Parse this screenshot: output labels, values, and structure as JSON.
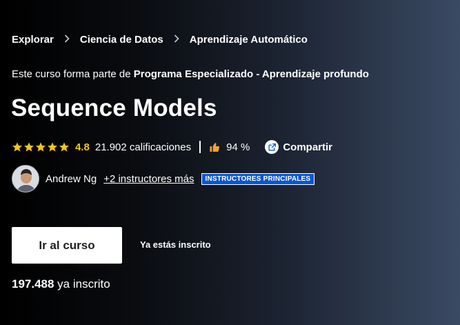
{
  "breadcrumb": {
    "items": [
      {
        "label": "Explorar"
      },
      {
        "label": "Ciencia de Datos"
      },
      {
        "label": "Aprendizaje Automático"
      }
    ]
  },
  "program": {
    "prefix": "Este curso forma parte de ",
    "name": "Programa Especializado - Aprendizaje profundo"
  },
  "course": {
    "title": "Sequence Models"
  },
  "ratings": {
    "stars": 5,
    "value": "4.8",
    "count_text": "21.902 calificaciones",
    "like_percent": "94 %",
    "star_color": "#f5c518",
    "icons": [
      "star-icon",
      "thumbs-up-icon",
      "share-icon"
    ]
  },
  "share": {
    "label": "Compartir"
  },
  "instructors": {
    "primary_name": "Andrew Ng",
    "more_link": "+2 instructores más",
    "badge": "INSTRUCTORES PRINCIPALES",
    "badge_color": "#0a56d0"
  },
  "cta": {
    "button_label": "Ir al curso",
    "enrolled_note": "Ya estás inscrito"
  },
  "enrollment": {
    "count": "197.488",
    "suffix": " ya inscrito"
  }
}
